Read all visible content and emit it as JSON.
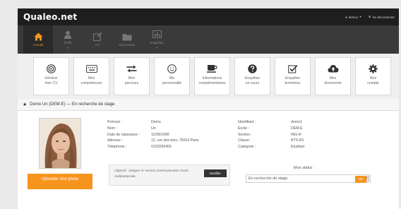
{
  "brand": "Qualeo.net",
  "topbar": {
    "user_label": "demo1",
    "logout_label": "Se déconnecter"
  },
  "nav": [
    {
      "label": "Accueil",
      "icon": "home-icon",
      "active": true
    },
    {
      "label": "Profil",
      "icon": "profile-icon",
      "active": false
    },
    {
      "label": "CV",
      "icon": "cv-icon",
      "active": false
    },
    {
      "label": "Documents",
      "icon": "folder-icon",
      "active": false
    },
    {
      "label": "Enquêtes",
      "icon": "chart-icon",
      "active": false
    }
  ],
  "tiles": [
    {
      "line1": "Générer",
      "line2": "mon CV",
      "icon": "target-icon"
    },
    {
      "line1": "Mes",
      "line2": "compétences",
      "icon": "keyboard-icon"
    },
    {
      "line1": "Mon",
      "line2": "parcours",
      "icon": "arrows-icon"
    },
    {
      "line1": "Ma",
      "line2": "personnalité",
      "icon": "smiley-icon"
    },
    {
      "line1": "Informations",
      "line2": "complémentaires",
      "icon": "coffee-icon"
    },
    {
      "line1": "Enquêtes",
      "line2": "en cours",
      "icon": "question-icon"
    },
    {
      "line1": "Enquêtes",
      "line2": "terminées",
      "icon": "checkbox-icon"
    },
    {
      "line1": "Mes",
      "line2": "documents",
      "icon": "cloud-upload-icon"
    },
    {
      "line1": "Mon",
      "line2": "compte",
      "icon": "cog-icon"
    }
  ],
  "panel": {
    "title": "Demo Un (DEM-E) — En recherche de stage"
  },
  "personal": {
    "labels": [
      "Prénom :",
      "Nom :",
      "Date de naissance :",
      "Adresse :",
      "Téléphone :"
    ],
    "values": [
      "Demo",
      "Un",
      "11/09/1990",
      "12, rue des bois, 75014 Paris",
      "0102030405"
    ]
  },
  "school": {
    "labels": [
      "Identifiant :",
      "Ecole :",
      "Section :",
      "Classe :",
      "Catégorie :"
    ],
    "values": [
      "demo1",
      "DEM-E",
      "ING-R",
      "BTS-R1",
      "Etudiant"
    ]
  },
  "objective": {
    "text": "Objectif : Intégrer le service communication d'une multinationale.",
    "button": "Modifier"
  },
  "status": {
    "label": "Mon statut :",
    "value": "En recherche de stage",
    "ok": "OK"
  },
  "upload": {
    "label": "Uploader une photo"
  },
  "colors": {
    "accent": "#f7941d",
    "topbar": "#1e1e1e",
    "navbar": "#3a3a3a"
  }
}
